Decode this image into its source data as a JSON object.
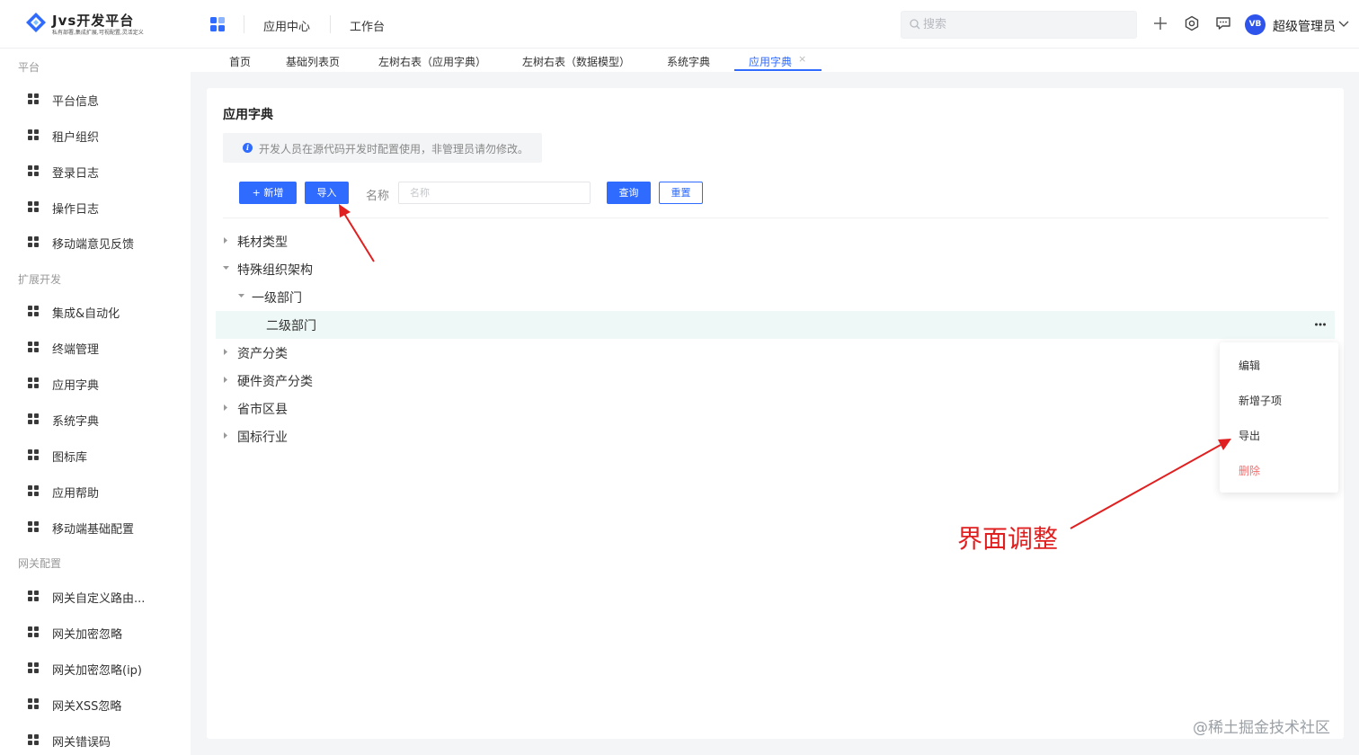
{
  "header": {
    "logo_title": "Jvs开发平台",
    "logo_subtitle": "私有部署,集成扩展,可视配置,灵活定义",
    "nav": [
      "应用中心",
      "工作台"
    ],
    "search_placeholder": "搜索",
    "user_avatar": "VB",
    "user_name": "超级管理员"
  },
  "sidebar": {
    "groups": [
      {
        "title": "平台",
        "items": [
          "平台信息",
          "租户组织",
          "登录日志",
          "操作日志",
          "移动端意见反馈"
        ]
      },
      {
        "title": "扩展开发",
        "items": [
          "集成&自动化",
          "终端管理",
          "应用字典",
          "系统字典",
          "图标库",
          "应用帮助",
          "移动端基础配置"
        ]
      },
      {
        "title": "网关配置",
        "items": [
          "网关自定义路由...",
          "网关加密忽略",
          "网关加密忽略(ip)",
          "网关XSS忽略",
          "网关错误码"
        ]
      }
    ]
  },
  "tabs": {
    "items": [
      "首页",
      "基础列表页",
      "左树右表（应用字典）",
      "左树右表（数据模型）",
      "系统字典",
      "应用字典"
    ],
    "active": "应用字典",
    "close_symbol": "×"
  },
  "page": {
    "title": "应用字典",
    "notice": "开发人员在源代码开发时配置使用，非管理员请勿修改。",
    "buttons": {
      "add": "+ 新增",
      "import": "导入",
      "query": "查询",
      "reset": "重置"
    },
    "name_label": "名称",
    "name_placeholder": "名称"
  },
  "tree": [
    {
      "label": "耗材类型",
      "level": 0,
      "state": "collapsed"
    },
    {
      "label": "特殊组织架构",
      "level": 0,
      "state": "expanded"
    },
    {
      "label": "一级部门",
      "level": 1,
      "state": "expanded"
    },
    {
      "label": "二级部门",
      "level": 2,
      "state": "leaf",
      "selected": true
    },
    {
      "label": "资产分类",
      "level": 0,
      "state": "collapsed"
    },
    {
      "label": "硬件资产分类",
      "level": 0,
      "state": "collapsed"
    },
    {
      "label": "省市区县",
      "level": 0,
      "state": "collapsed"
    },
    {
      "label": "国标行业",
      "level": 0,
      "state": "collapsed"
    }
  ],
  "context_menu": {
    "items": [
      "编辑",
      "新增子项",
      "导出",
      "删除"
    ],
    "danger_item": "删除"
  },
  "annotation": {
    "text": "界面调整",
    "color": "#e02020"
  },
  "source_watermark": "@稀土掘金技术社区",
  "colors": {
    "primary": "#2f6bff",
    "selected_row": "#eef8f6",
    "danger": "#f56c6c"
  }
}
